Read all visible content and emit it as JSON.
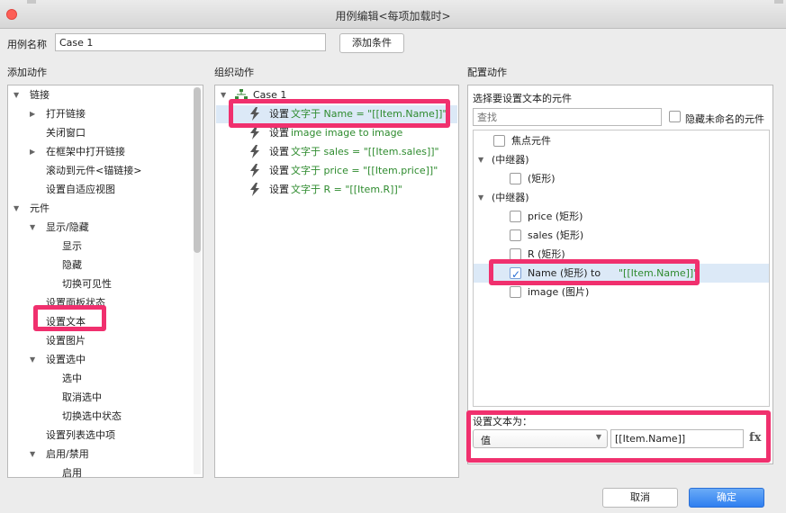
{
  "window": {
    "title": "用例编辑<每项加载时>"
  },
  "case_name": {
    "label": "用例名称",
    "value": "Case 1",
    "add_condition": "添加条件"
  },
  "sections": {
    "add_action": "添加动作",
    "org_action": "组织动作",
    "config_action": "配置动作"
  },
  "left_tree": [
    {
      "label": "链接",
      "level": 0,
      "arrow": "down"
    },
    {
      "label": "打开链接",
      "level": 1,
      "arrow": "right"
    },
    {
      "label": "关闭窗口",
      "level": 1,
      "arrow": ""
    },
    {
      "label": "在框架中打开链接",
      "level": 1,
      "arrow": "right"
    },
    {
      "label": "滚动到元件<锚链接>",
      "level": 1,
      "arrow": ""
    },
    {
      "label": "设置自适应视图",
      "level": 1,
      "arrow": ""
    },
    {
      "label": "元件",
      "level": 0,
      "arrow": "down"
    },
    {
      "label": "显示/隐藏",
      "level": 1,
      "arrow": "down"
    },
    {
      "label": "显示",
      "level": 2,
      "arrow": ""
    },
    {
      "label": "隐藏",
      "level": 2,
      "arrow": ""
    },
    {
      "label": "切换可见性",
      "level": 2,
      "arrow": ""
    },
    {
      "label": "设置面板状态",
      "level": 1,
      "arrow": ""
    },
    {
      "label": "设置文本",
      "level": 1,
      "arrow": ""
    },
    {
      "label": "设置图片",
      "level": 1,
      "arrow": ""
    },
    {
      "label": "设置选中",
      "level": 1,
      "arrow": "down"
    },
    {
      "label": "选中",
      "level": 2,
      "arrow": ""
    },
    {
      "label": "取消选中",
      "level": 2,
      "arrow": ""
    },
    {
      "label": "切换选中状态",
      "level": 2,
      "arrow": ""
    },
    {
      "label": "设置列表选中项",
      "level": 1,
      "arrow": ""
    },
    {
      "label": "启用/禁用",
      "level": 1,
      "arrow": "down"
    },
    {
      "label": "启用",
      "level": 2,
      "arrow": ""
    }
  ],
  "org": {
    "case_label": "Case 1",
    "actions": [
      {
        "prefix": "设置",
        "text": "文字于 Name = \"[[Item.Name]]\""
      },
      {
        "prefix": "设置",
        "text": "image image to image"
      },
      {
        "prefix": "设置",
        "text": "文字于 sales = \"[[Item.sales]]\""
      },
      {
        "prefix": "设置",
        "text": "文字于 price = \"[[Item.price]]\""
      },
      {
        "prefix": "设置",
        "text": "文字于 R = \"[[Item.R]]\""
      }
    ]
  },
  "config": {
    "choose_label": "选择要设置文本的元件",
    "search_placeholder": "查找",
    "hide_unnamed": "隐藏未命名的元件",
    "items": [
      {
        "label": "焦点元件",
        "indent": 1,
        "arrow": "",
        "checkbox": true,
        "checked": false
      },
      {
        "label": "(中继器)",
        "indent": 0,
        "arrow": "down",
        "checkbox": false,
        "checked": false
      },
      {
        "label": "(矩形)",
        "indent": 2,
        "arrow": "",
        "checkbox": true,
        "checked": false
      },
      {
        "label": "(中继器)",
        "indent": 0,
        "arrow": "down",
        "checkbox": false,
        "checked": false
      },
      {
        "label": "price (矩形)",
        "indent": 2,
        "arrow": "",
        "checkbox": true,
        "checked": false
      },
      {
        "label": "sales (矩形)",
        "indent": 2,
        "arrow": "",
        "checkbox": true,
        "checked": false
      },
      {
        "label": "R (矩形)",
        "indent": 2,
        "arrow": "",
        "checkbox": true,
        "checked": false
      },
      {
        "label": "Name (矩形) to",
        "suffix": "\"[[Item.Name]]\"",
        "indent": 2,
        "arrow": "",
        "checkbox": true,
        "checked": true
      },
      {
        "label": "image (图片)",
        "indent": 2,
        "arrow": "",
        "checkbox": true,
        "checked": false
      }
    ],
    "set_text_label": "设置文本为：",
    "value_select": "值",
    "value_input": "[[Item.Name]]",
    "fx_label": "fx"
  },
  "footer": {
    "cancel": "取消",
    "ok": "确定"
  },
  "colors": {
    "highlight": "#f0306e",
    "primary_button": "#3c8cf0",
    "green_text": "#2e8b2e"
  }
}
